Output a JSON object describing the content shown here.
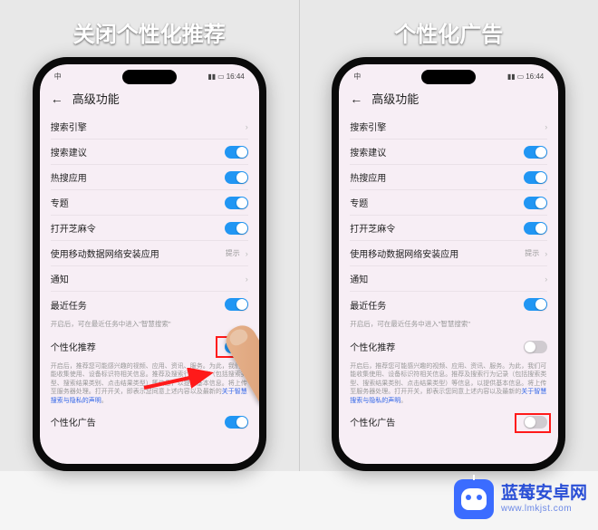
{
  "titles": {
    "left": "关闭个性化推荐",
    "right": "个性化广告"
  },
  "statusbar": {
    "carrier": "中",
    "time": "16:44"
  },
  "page": {
    "header": "高级功能"
  },
  "rows": {
    "search_engine": "搜索引擎",
    "search_suggest": "搜索建议",
    "hot_apps": "热搜应用",
    "special": "专题",
    "sesame": "打开芝麻令",
    "mobile_install": "使用移动数据网络安装应用",
    "mobile_install_hint": "提示",
    "notify": "通知",
    "recent_tasks": "最近任务",
    "recent_tasks_desc": "开启后，可在最近任务中进入\"智慧搜索\"",
    "personal_rec": "个性化推荐",
    "personal_desc_pre": "开启后，推荐您可能感兴趣的视频、应用、资讯、服务。为此，我们可能收集使用、设备标识符相关信息。推荐及搜索行为记录（包括搜索类型、搜索结果类别、点击结果类型）等信息，以提供基本信息。将上传至服务器处理。打开开关，即表示您同意上述内容以及最新的",
    "personal_desc_link": "关于智慧搜索与隐私的声明",
    "personal_ads": "个性化广告"
  },
  "watermark": {
    "cn": "蓝莓安卓网",
    "url": "www.lmkjst.com"
  }
}
